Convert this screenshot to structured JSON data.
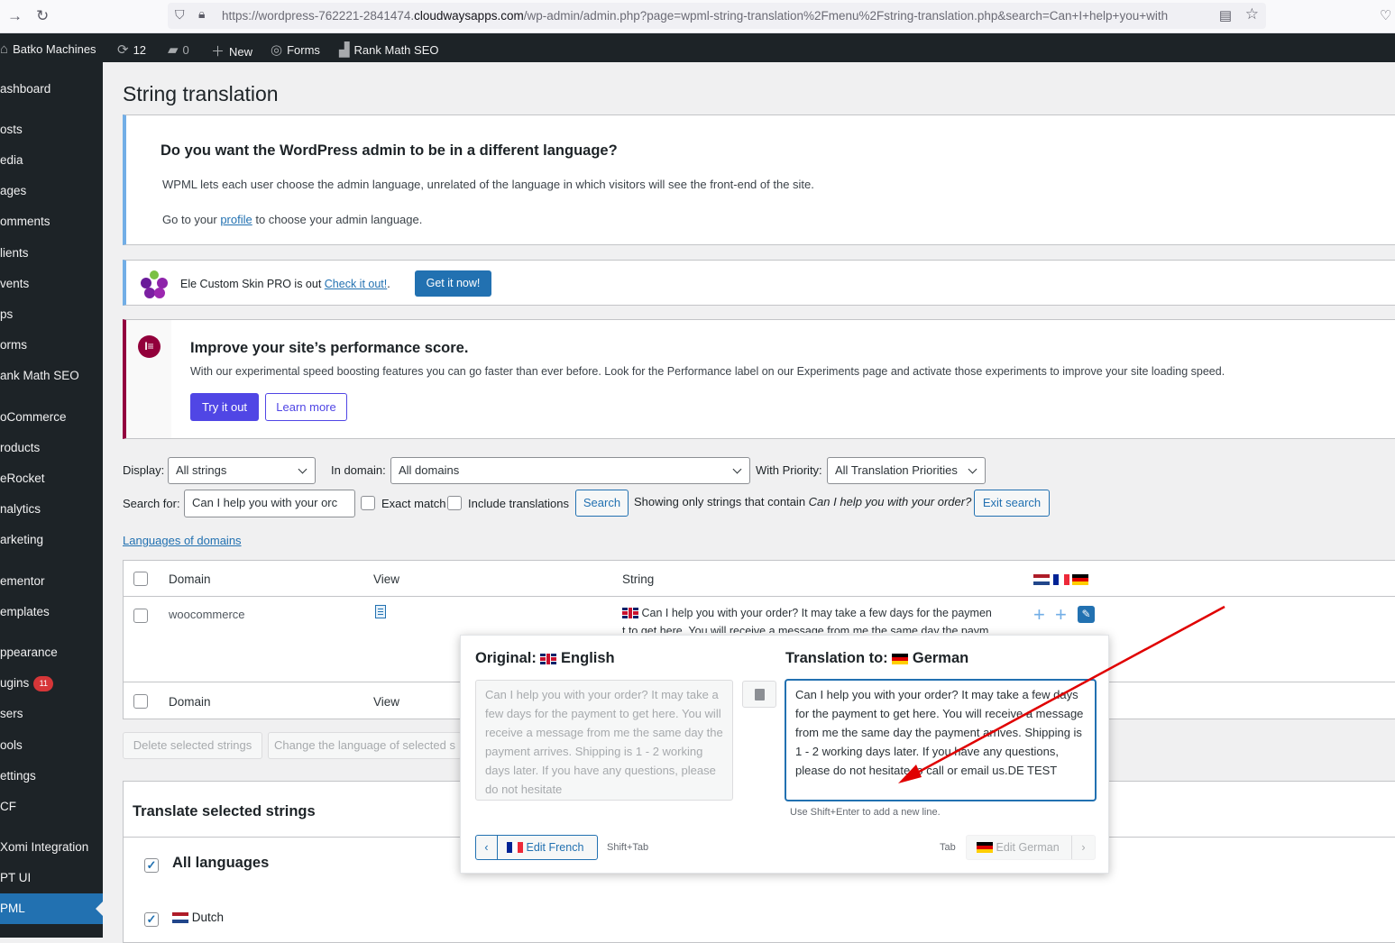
{
  "browser": {
    "url_prefix": "https://wordpress-762221-2841474.",
    "url_host": "cloudwaysapps.com",
    "url_rest": "/wp-admin/admin.php?page=wpml-string-translation%2Fmenu%2Fstring-translation.php&search=Can+I+help+you+with"
  },
  "adminbar": {
    "site_name": "Batko Machines",
    "updates": "12",
    "comments": "0",
    "new_label": "New",
    "forms_label": "Forms",
    "rankmath_label": "Rank Math SEO"
  },
  "sidebar": {
    "items": [
      {
        "label": "ashboard"
      },
      {
        "label": "osts"
      },
      {
        "label": "edia"
      },
      {
        "label": "ages"
      },
      {
        "label": "omments"
      },
      {
        "label": "lients"
      },
      {
        "label": "vents"
      },
      {
        "label": "ps"
      },
      {
        "label": "orms"
      },
      {
        "label": "ank Math SEO"
      },
      {
        "label": "oCommerce"
      },
      {
        "label": "roducts"
      },
      {
        "label": "eRocket"
      },
      {
        "label": "nalytics"
      },
      {
        "label": "arketing"
      },
      {
        "label": "ementor"
      },
      {
        "label": "emplates"
      },
      {
        "label": "ppearance"
      },
      {
        "label": "ugins",
        "badge": "11"
      },
      {
        "label": "sers"
      },
      {
        "label": "ools"
      },
      {
        "label": "ettings"
      },
      {
        "label": "CF"
      },
      {
        "label": "Xomi Integration"
      },
      {
        "label": "PT UI"
      },
      {
        "label": "PML"
      }
    ]
  },
  "page": {
    "title": "String translation"
  },
  "notice_language": {
    "heading": "Do you want the WordPress admin to be in a different language?",
    "text1": "WPML lets each user choose the admin language, unrelated of the language in which visitors will see the front-end of the site.",
    "text2_before": "Go to your ",
    "text2_link": "profile",
    "text2_after": " to choose your admin language."
  },
  "notice_skin": {
    "text_before": "Ele Custom Skin PRO is out ",
    "link": "Check it out!",
    "text_after": ".",
    "button": "Get it now!"
  },
  "notice_elementor": {
    "heading": "Improve your site’s performance score.",
    "text": "With our experimental speed boosting features you can go faster than ever before. Look for the Performance label on our Experiments page and activate those experiments to improve your site loading speed.",
    "try_button": "Try it out",
    "learn_button": "Learn more"
  },
  "filters": {
    "display_label": "Display:",
    "display_value": "All strings",
    "domain_label": "In domain:",
    "domain_value": "All domains",
    "priority_label": "With Priority:",
    "priority_value": "All Translation Priorities",
    "search_label": "Search for:",
    "search_value": "Can I help you with your orc",
    "exact_match": "Exact match",
    "include_translations": "Include translations",
    "search_button": "Search",
    "showing_text": "Showing only strings that contain ",
    "showing_query": "Can I help you with your order?",
    "exit_button": "Exit search",
    "languages_link": "Languages of domains"
  },
  "table": {
    "headers": {
      "domain": "Domain",
      "view": "View",
      "string": "String"
    },
    "row": {
      "domain": "woocommerce",
      "string_line1": "Can I help you with your order? It may take a few days for the paymen",
      "string_line2": "t to get here. You will receive a message from me the same day the paym"
    }
  },
  "bulk": {
    "delete": "Delete selected strings",
    "change_language": "Change the language of selected s"
  },
  "translate_section": {
    "heading": "Translate selected strings",
    "all_languages": "All languages",
    "dutch": "Dutch"
  },
  "popup": {
    "original_label": "Original:",
    "original_lang": "English",
    "translation_label": "Translation to:",
    "translation_lang": "German",
    "original_text": "Can I help you with your order? It may take a few days for the payment to get here. You will receive a message from me the same day the payment arrives. Shipping is 1 - 2 working days later. If you have any questions, please do not hesitate",
    "translation_text": "Can I help you with your order? It may take a few days for the payment to get here. You will receive a message from me the same day the payment arrives. Shipping is 1 - 2 working days later. If you have any questions, please do not hesitate to call or email us.DE TEST",
    "hint": "Use Shift+Enter to add a new line.",
    "prev_button": "Edit French",
    "prev_shortcut": "Shift+Tab",
    "next_shortcut": "Tab",
    "next_button": "Edit German"
  },
  "colors": {
    "wp_blue": "#2271b1",
    "admin_dark": "#1d2327",
    "elementor_maroon": "#92003b",
    "annotation_red": "#e00000"
  }
}
